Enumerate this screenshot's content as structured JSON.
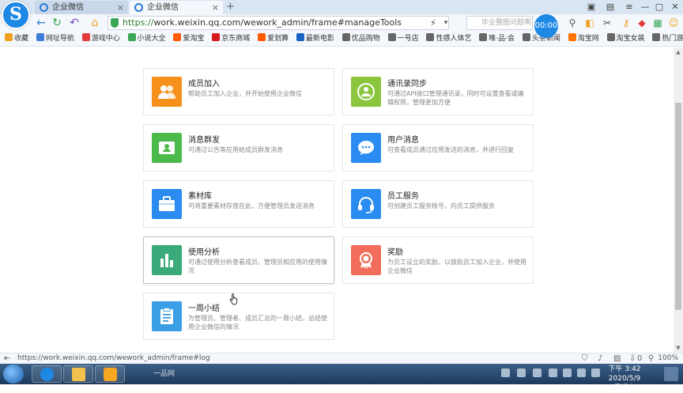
{
  "browser": {
    "tabs": [
      {
        "label": "企业微信"
      },
      {
        "label": "企业微信"
      }
    ],
    "new_tab": "+",
    "url_scheme": "https://",
    "url_rest": "work.weixin.qq.com/wework_admin/frame#manageTools",
    "search_placeholder": "毕业整图问题啊",
    "timer": "00:00",
    "status_url": "https://work.weixin.qq.com/wework_admin/frame#log",
    "zoom": "100%",
    "status_count": "0"
  },
  "bookmarks": [
    {
      "label": "收藏",
      "color": "#f0a020"
    },
    {
      "label": "网址导航",
      "color": "#3b7dd8"
    },
    {
      "label": "游戏中心",
      "color": "#e23b3b"
    },
    {
      "label": "小说大全",
      "color": "#3aa757"
    },
    {
      "label": "爱淘宝",
      "color": "#ff5a00"
    },
    {
      "label": "京东商城",
      "color": "#d71920"
    },
    {
      "label": "爱划算",
      "color": "#ff5a00"
    },
    {
      "label": "最新电影",
      "color": "#1a62c5"
    },
    {
      "label": "优品购物",
      "color": "#666666"
    },
    {
      "label": "一号店",
      "color": "#666666"
    },
    {
      "label": "性感人体艺",
      "color": "#666666"
    },
    {
      "label": "唯·品·会",
      "color": "#666666"
    },
    {
      "label": "头条新闻",
      "color": "#666666"
    },
    {
      "label": "淘宝网",
      "color": "#ff7300"
    },
    {
      "label": "淘宝女装",
      "color": "#666666"
    },
    {
      "label": "热门游戏",
      "color": "#666666"
    },
    {
      "label": "女",
      "color": "#666666"
    }
  ],
  "cards": [
    {
      "title": "成员加入",
      "desc": "帮助员工加入企业，并开始使用企业微信",
      "color": "#f5901a",
      "icon": "users-icon"
    },
    {
      "title": "通讯录同步",
      "desc": "可通过API接口管理通讯录，同时可设置查看或编辑权限，管理更加方便",
      "color": "#8cc63e",
      "icon": "contact-sync-icon"
    },
    {
      "title": "消息群发",
      "desc": "可通过公告等应用给成员群发消息",
      "color": "#4cba4a",
      "icon": "broadcast-icon"
    },
    {
      "title": "用户消息",
      "desc": "可查看成员通过应用发送的消息，并进行回复",
      "color": "#2a8cf0",
      "icon": "chat-icon"
    },
    {
      "title": "素材库",
      "desc": "可将重要素材存放在此，方便管理员发送消息",
      "color": "#2a8cf0",
      "icon": "folder-icon"
    },
    {
      "title": "员工服务",
      "desc": "可创建员工服务帐号，向员工提供服务",
      "color": "#2a8cf0",
      "icon": "headset-icon"
    },
    {
      "title": "使用分析",
      "desc": "可通过使用分析查看成员、管理员和应用的使用情况",
      "color": "#3aaa7a",
      "icon": "bar-chart-icon"
    },
    {
      "title": "奖励",
      "desc": "为员工设立的奖励，以鼓励员工加入企业，并使用企业微信",
      "color": "#f26d5b",
      "icon": "medal-icon"
    },
    {
      "title": "一周小结",
      "desc": "为管理员、管理者、成员汇总的一周小结，总结使用企业微信的情况",
      "color": "#3b9fe6",
      "icon": "clipboard-icon"
    }
  ],
  "taskbar": {
    "task_label": "一品网",
    "time": "下午 3:42",
    "date": "2020/5/9 星期六"
  }
}
